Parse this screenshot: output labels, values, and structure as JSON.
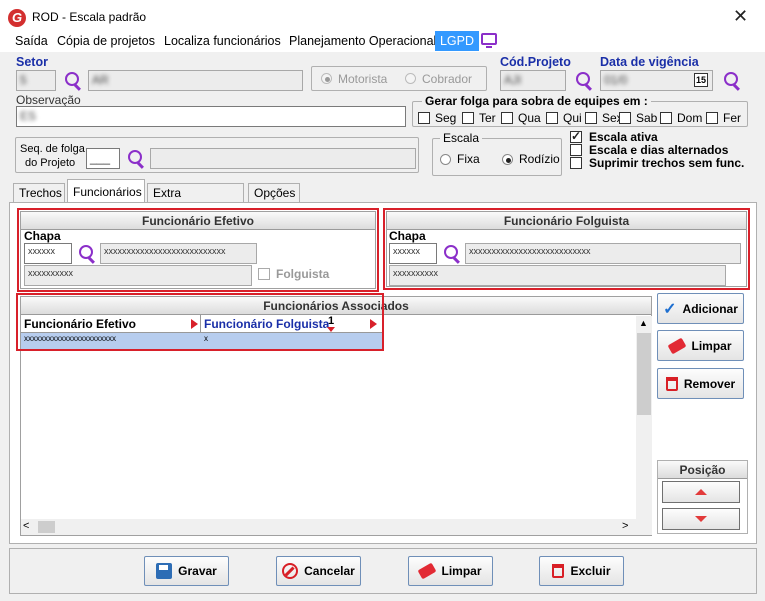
{
  "window": {
    "title": "ROD - Escala padrão",
    "app_icon": "G"
  },
  "menu": [
    "Saída",
    "Cópia de projetos",
    "Localiza funcionários",
    "Planejamento Operacional",
    "LGPD"
  ],
  "header": {
    "setor_label": "Setor",
    "setor_code": "5",
    "setor_name": "AR",
    "tipo_options": [
      "Motorista",
      "Cobrador"
    ],
    "cod_projeto_label": "Cód.Projeto",
    "cod_projeto_value": "AJI",
    "data_vigencia_label": "Data de vigência",
    "data_vigencia_value": "01/0",
    "calendar_day": "15",
    "observacao_label": "Observação",
    "observacao_value": "ES",
    "folga_group_title": "Gerar folga para sobra de equipes em :",
    "folga_days": [
      "Seg",
      "Ter",
      "Qua",
      "Qui",
      "Sex",
      "Sab",
      "Dom",
      "Fer"
    ],
    "seq_folga_label_1": "Seq. de folga",
    "seq_folga_label_2": "do Projeto",
    "seq_folga_value": "___",
    "escala_group_title": "Escala",
    "escala_options": [
      "Fixa",
      "Rodízio"
    ],
    "flags": [
      {
        "label": "Escala ativa",
        "checked": true
      },
      {
        "label": "Escala e dias alternados",
        "checked": false
      },
      {
        "label": "Suprimir trechos sem func.",
        "checked": false
      }
    ]
  },
  "tabs": [
    "Trechos",
    "Funcionários",
    "Extra programado",
    "Opções"
  ],
  "efetivo": {
    "title": "Funcionário Efetivo",
    "chapa_label": "Chapa",
    "chapa_value": "xxxxxx",
    "name_value": "xxxxxxxxxxxxxxxxxxxxxxxxxxx",
    "extra_value": "xxxxxxxxxx",
    "folguista_label": "Folguista"
  },
  "folguista": {
    "title": "Funcionário Folguista",
    "chapa_label": "Chapa",
    "chapa_value": "xxxxxx",
    "name_value": "xxxxxxxxxxxxxxxxxxxxxxxxxxx",
    "extra_value": "xxxxxxxxxx"
  },
  "associados": {
    "title": "Funcionários Associados",
    "col_efetivo": "Funcionário Efetivo",
    "col_folguista": "Funcionário Folguista",
    "sort_indicator": "1",
    "rows": [
      {
        "efetivo": "xxxxxxxxxxxxxxxxxxxxxxx",
        "folguista": "x"
      }
    ]
  },
  "side_buttons": {
    "adicionar": "Adicionar",
    "limpar": "Limpar",
    "remover": "Remover",
    "posicao": "Posição"
  },
  "bottom_buttons": {
    "gravar": "Gravar",
    "cancelar": "Cancelar",
    "limpar": "Limpar",
    "excluir": "Excluir"
  },
  "colors": {
    "accent_blue": "#1a2fa8",
    "highlight_red": "#d8202a",
    "lgpd_bg": "#3399ff",
    "selected_row": "#b7cdee"
  }
}
